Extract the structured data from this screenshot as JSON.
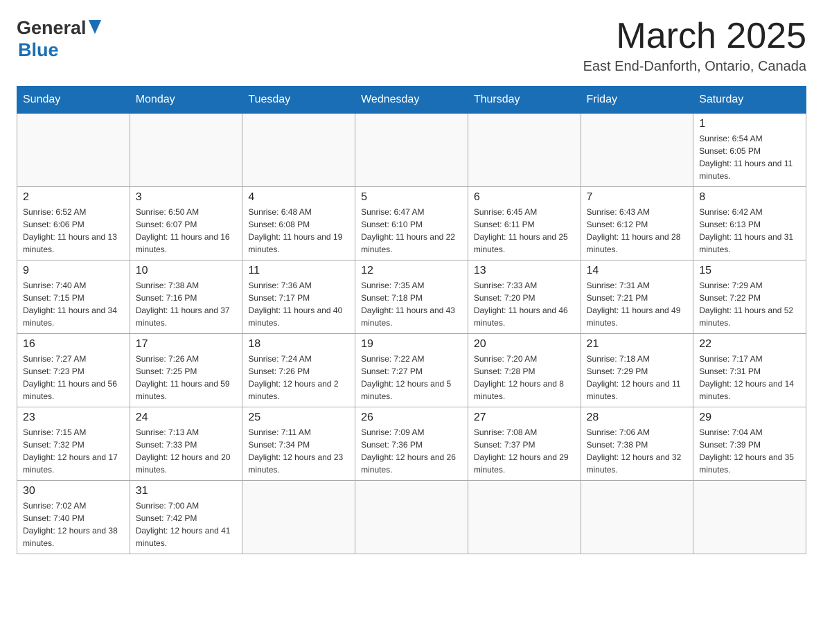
{
  "header": {
    "logo_general": "General",
    "logo_blue": "Blue",
    "month_title": "March 2025",
    "location": "East End-Danforth, Ontario, Canada"
  },
  "days_of_week": [
    "Sunday",
    "Monday",
    "Tuesday",
    "Wednesday",
    "Thursday",
    "Friday",
    "Saturday"
  ],
  "weeks": [
    [
      {
        "day": "",
        "info": ""
      },
      {
        "day": "",
        "info": ""
      },
      {
        "day": "",
        "info": ""
      },
      {
        "day": "",
        "info": ""
      },
      {
        "day": "",
        "info": ""
      },
      {
        "day": "",
        "info": ""
      },
      {
        "day": "1",
        "info": "Sunrise: 6:54 AM\nSunset: 6:05 PM\nDaylight: 11 hours and 11 minutes."
      }
    ],
    [
      {
        "day": "2",
        "info": "Sunrise: 6:52 AM\nSunset: 6:06 PM\nDaylight: 11 hours and 13 minutes."
      },
      {
        "day": "3",
        "info": "Sunrise: 6:50 AM\nSunset: 6:07 PM\nDaylight: 11 hours and 16 minutes."
      },
      {
        "day": "4",
        "info": "Sunrise: 6:48 AM\nSunset: 6:08 PM\nDaylight: 11 hours and 19 minutes."
      },
      {
        "day": "5",
        "info": "Sunrise: 6:47 AM\nSunset: 6:10 PM\nDaylight: 11 hours and 22 minutes."
      },
      {
        "day": "6",
        "info": "Sunrise: 6:45 AM\nSunset: 6:11 PM\nDaylight: 11 hours and 25 minutes."
      },
      {
        "day": "7",
        "info": "Sunrise: 6:43 AM\nSunset: 6:12 PM\nDaylight: 11 hours and 28 minutes."
      },
      {
        "day": "8",
        "info": "Sunrise: 6:42 AM\nSunset: 6:13 PM\nDaylight: 11 hours and 31 minutes."
      }
    ],
    [
      {
        "day": "9",
        "info": "Sunrise: 7:40 AM\nSunset: 7:15 PM\nDaylight: 11 hours and 34 minutes."
      },
      {
        "day": "10",
        "info": "Sunrise: 7:38 AM\nSunset: 7:16 PM\nDaylight: 11 hours and 37 minutes."
      },
      {
        "day": "11",
        "info": "Sunrise: 7:36 AM\nSunset: 7:17 PM\nDaylight: 11 hours and 40 minutes."
      },
      {
        "day": "12",
        "info": "Sunrise: 7:35 AM\nSunset: 7:18 PM\nDaylight: 11 hours and 43 minutes."
      },
      {
        "day": "13",
        "info": "Sunrise: 7:33 AM\nSunset: 7:20 PM\nDaylight: 11 hours and 46 minutes."
      },
      {
        "day": "14",
        "info": "Sunrise: 7:31 AM\nSunset: 7:21 PM\nDaylight: 11 hours and 49 minutes."
      },
      {
        "day": "15",
        "info": "Sunrise: 7:29 AM\nSunset: 7:22 PM\nDaylight: 11 hours and 52 minutes."
      }
    ],
    [
      {
        "day": "16",
        "info": "Sunrise: 7:27 AM\nSunset: 7:23 PM\nDaylight: 11 hours and 56 minutes."
      },
      {
        "day": "17",
        "info": "Sunrise: 7:26 AM\nSunset: 7:25 PM\nDaylight: 11 hours and 59 minutes."
      },
      {
        "day": "18",
        "info": "Sunrise: 7:24 AM\nSunset: 7:26 PM\nDaylight: 12 hours and 2 minutes."
      },
      {
        "day": "19",
        "info": "Sunrise: 7:22 AM\nSunset: 7:27 PM\nDaylight: 12 hours and 5 minutes."
      },
      {
        "day": "20",
        "info": "Sunrise: 7:20 AM\nSunset: 7:28 PM\nDaylight: 12 hours and 8 minutes."
      },
      {
        "day": "21",
        "info": "Sunrise: 7:18 AM\nSunset: 7:29 PM\nDaylight: 12 hours and 11 minutes."
      },
      {
        "day": "22",
        "info": "Sunrise: 7:17 AM\nSunset: 7:31 PM\nDaylight: 12 hours and 14 minutes."
      }
    ],
    [
      {
        "day": "23",
        "info": "Sunrise: 7:15 AM\nSunset: 7:32 PM\nDaylight: 12 hours and 17 minutes."
      },
      {
        "day": "24",
        "info": "Sunrise: 7:13 AM\nSunset: 7:33 PM\nDaylight: 12 hours and 20 minutes."
      },
      {
        "day": "25",
        "info": "Sunrise: 7:11 AM\nSunset: 7:34 PM\nDaylight: 12 hours and 23 minutes."
      },
      {
        "day": "26",
        "info": "Sunrise: 7:09 AM\nSunset: 7:36 PM\nDaylight: 12 hours and 26 minutes."
      },
      {
        "day": "27",
        "info": "Sunrise: 7:08 AM\nSunset: 7:37 PM\nDaylight: 12 hours and 29 minutes."
      },
      {
        "day": "28",
        "info": "Sunrise: 7:06 AM\nSunset: 7:38 PM\nDaylight: 12 hours and 32 minutes."
      },
      {
        "day": "29",
        "info": "Sunrise: 7:04 AM\nSunset: 7:39 PM\nDaylight: 12 hours and 35 minutes."
      }
    ],
    [
      {
        "day": "30",
        "info": "Sunrise: 7:02 AM\nSunset: 7:40 PM\nDaylight: 12 hours and 38 minutes."
      },
      {
        "day": "31",
        "info": "Sunrise: 7:00 AM\nSunset: 7:42 PM\nDaylight: 12 hours and 41 minutes."
      },
      {
        "day": "",
        "info": ""
      },
      {
        "day": "",
        "info": ""
      },
      {
        "day": "",
        "info": ""
      },
      {
        "day": "",
        "info": ""
      },
      {
        "day": "",
        "info": ""
      }
    ]
  ]
}
